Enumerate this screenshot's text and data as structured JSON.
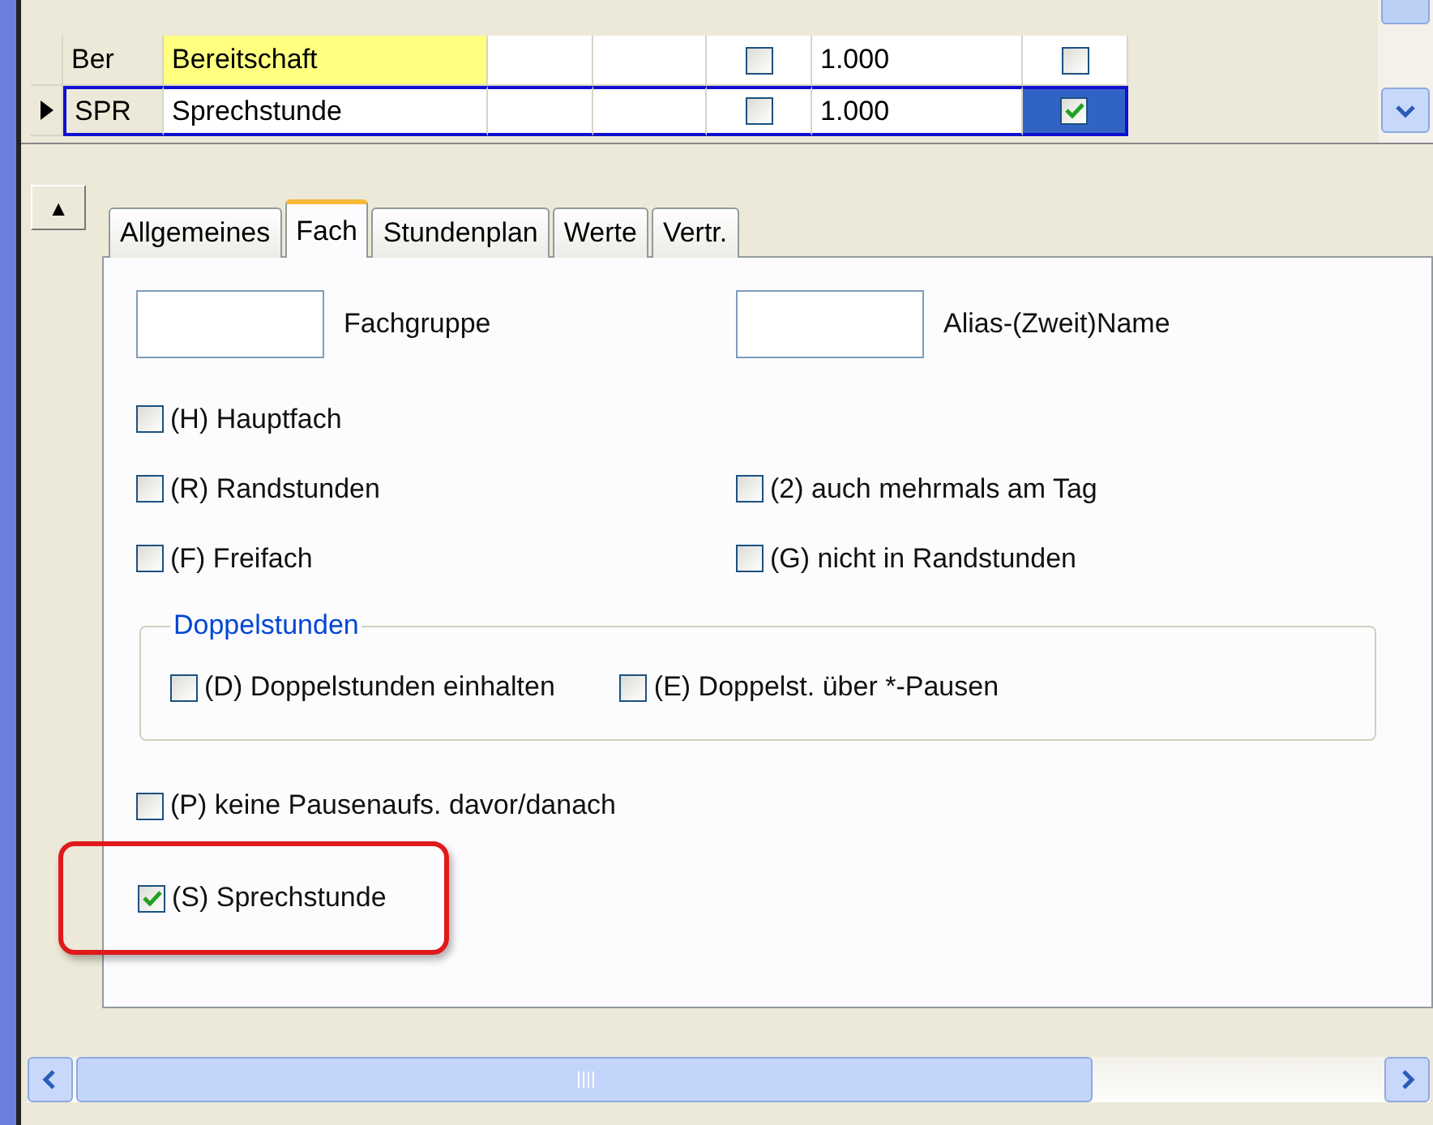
{
  "grid": {
    "rows": [
      {
        "current": false,
        "selected": false,
        "code": "Ber",
        "name": "Bereitschaft",
        "name_highlight": true,
        "flag_1": false,
        "value": "1.000",
        "flag_2": false
      },
      {
        "current": true,
        "selected": true,
        "code": "SPR",
        "name": "Sprechstunde",
        "name_highlight": false,
        "flag_1": false,
        "value": "1.000",
        "flag_2": true
      }
    ]
  },
  "panel": {
    "collapse_button": "▲",
    "tabs": [
      {
        "label": "Allgemeines",
        "selected": false
      },
      {
        "label": "Fach",
        "selected": true
      },
      {
        "label": "Stundenplan",
        "selected": false
      },
      {
        "label": "Werte",
        "selected": false
      },
      {
        "label": "Vertr.",
        "selected": false
      }
    ],
    "fields": [
      {
        "label": "Fachgruppe"
      },
      {
        "label": "Alias-(Zweit)Name"
      }
    ],
    "options_left": [
      {
        "label": "(H) Hauptfach",
        "checked": false
      },
      {
        "label": "(R) Randstunden",
        "checked": false
      },
      {
        "label": "(F) Freifach",
        "checked": false
      }
    ],
    "options_right": [
      {
        "label": "(2) auch mehrmals am Tag",
        "checked": false
      },
      {
        "label": "(G) nicht in Randstunden",
        "checked": false
      }
    ],
    "group": {
      "title": "Doppelstunden",
      "options": [
        {
          "label": "(D) Doppelstunden einhalten",
          "checked": false
        },
        {
          "label": "(E) Doppelst. über *-Pausen",
          "checked": false
        }
      ]
    },
    "options_bottom": [
      {
        "label": "(P) keine Pausenaufs. davor/danach",
        "checked": false,
        "emphasized": false
      },
      {
        "label": "(S) Sprechstunde",
        "checked": true,
        "emphasized": true
      }
    ]
  }
}
